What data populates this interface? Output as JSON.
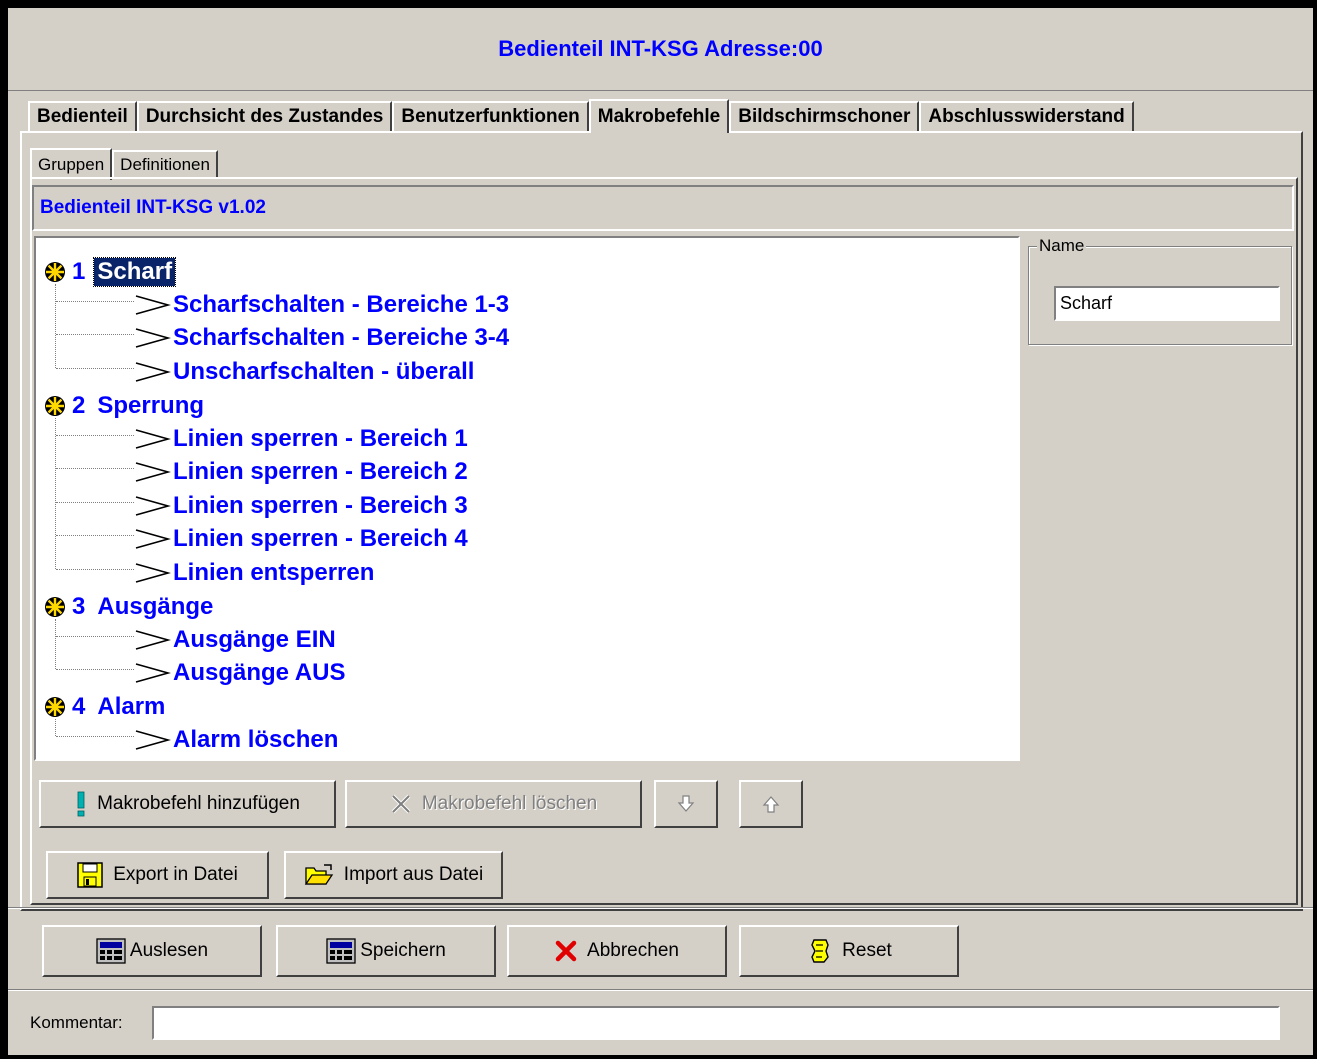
{
  "window": {
    "title": "Bedienteil INT-KSG Adresse:00"
  },
  "tabs": [
    {
      "label": "Bedienteil",
      "active": false
    },
    {
      "label": "Durchsicht des Zustandes",
      "active": false
    },
    {
      "label": "Benutzerfunktionen",
      "active": false
    },
    {
      "label": "Makrobefehle",
      "active": true
    },
    {
      "label": "Bildschirmschoner",
      "active": false
    },
    {
      "label": "Abschlusswiderstand",
      "active": false
    }
  ],
  "subtabs": [
    {
      "label": "Gruppen",
      "active": true
    },
    {
      "label": "Definitionen",
      "active": false
    }
  ],
  "version_label": "Bedienteil INT-KSG v1.02",
  "tree": {
    "groups": [
      {
        "number": "1",
        "label": "Scharf",
        "selected": true,
        "children": [
          "Scharfschalten - Bereiche 1-3",
          "Scharfschalten - Bereiche 3-4",
          "Unscharfschalten - überall"
        ]
      },
      {
        "number": "2",
        "label": "Sperrung",
        "selected": false,
        "children": [
          "Linien sperren - Bereich 1",
          "Linien sperren - Bereich 2",
          "Linien sperren - Bereich 3",
          "Linien sperren - Bereich 4",
          "Linien entsperren"
        ]
      },
      {
        "number": "3",
        "label": "Ausgänge",
        "selected": false,
        "children": [
          "Ausgänge EIN",
          "Ausgänge AUS"
        ]
      },
      {
        "number": "4",
        "label": "Alarm",
        "selected": false,
        "children": [
          "Alarm löschen"
        ]
      }
    ]
  },
  "name_panel": {
    "legend": "Name",
    "value": "Scharf"
  },
  "buttons": {
    "add_macro": "Makrobefehl hinzufügen",
    "delete_macro": "Makrobefehl löschen",
    "export": "Export in Datei",
    "import": "Import aus Datei",
    "read": "Auslesen",
    "save": "Speichern",
    "cancel": "Abbrechen",
    "reset": "Reset"
  },
  "comment": {
    "label": "Kommentar:",
    "value": ""
  },
  "colors": {
    "accent": "#0000ff",
    "selection": "#0a246a",
    "face": "#d4d0c8"
  },
  "icons": {
    "group_node": "star-bullet-icon",
    "macro_node": "triangle-arrow-icon",
    "add_macro": "exclamation-icon",
    "delete_macro": "cross-icon",
    "move_down": "arrow-down-icon",
    "move_up": "arrow-up-icon",
    "export": "floppy-disk-icon",
    "import": "open-folder-icon",
    "read": "calculator-icon",
    "save": "calculator-icon",
    "cancel": "red-x-icon",
    "reset": "reset-icon"
  }
}
